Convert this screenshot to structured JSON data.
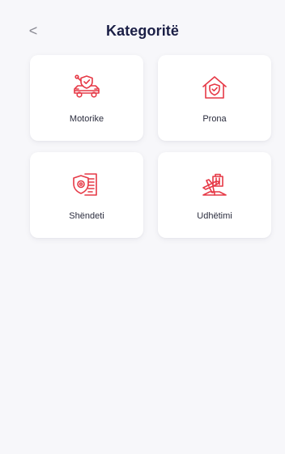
{
  "header": {
    "back_icon": "chevron-left-icon",
    "back_glyph": "<",
    "title": "Kategoritë"
  },
  "categories": [
    {
      "label": "Motorike",
      "icon": "car-shield-icon"
    },
    {
      "label": "Prona",
      "icon": "house-shield-icon"
    },
    {
      "label": "Shëndeti",
      "icon": "health-document-icon"
    },
    {
      "label": "Udhëtimi",
      "icon": "airplane-suitcase-icon"
    }
  ],
  "colors": {
    "accent": "#e63946",
    "title": "#1b1f46",
    "background": "#f7f7fa",
    "card": "#ffffff"
  }
}
